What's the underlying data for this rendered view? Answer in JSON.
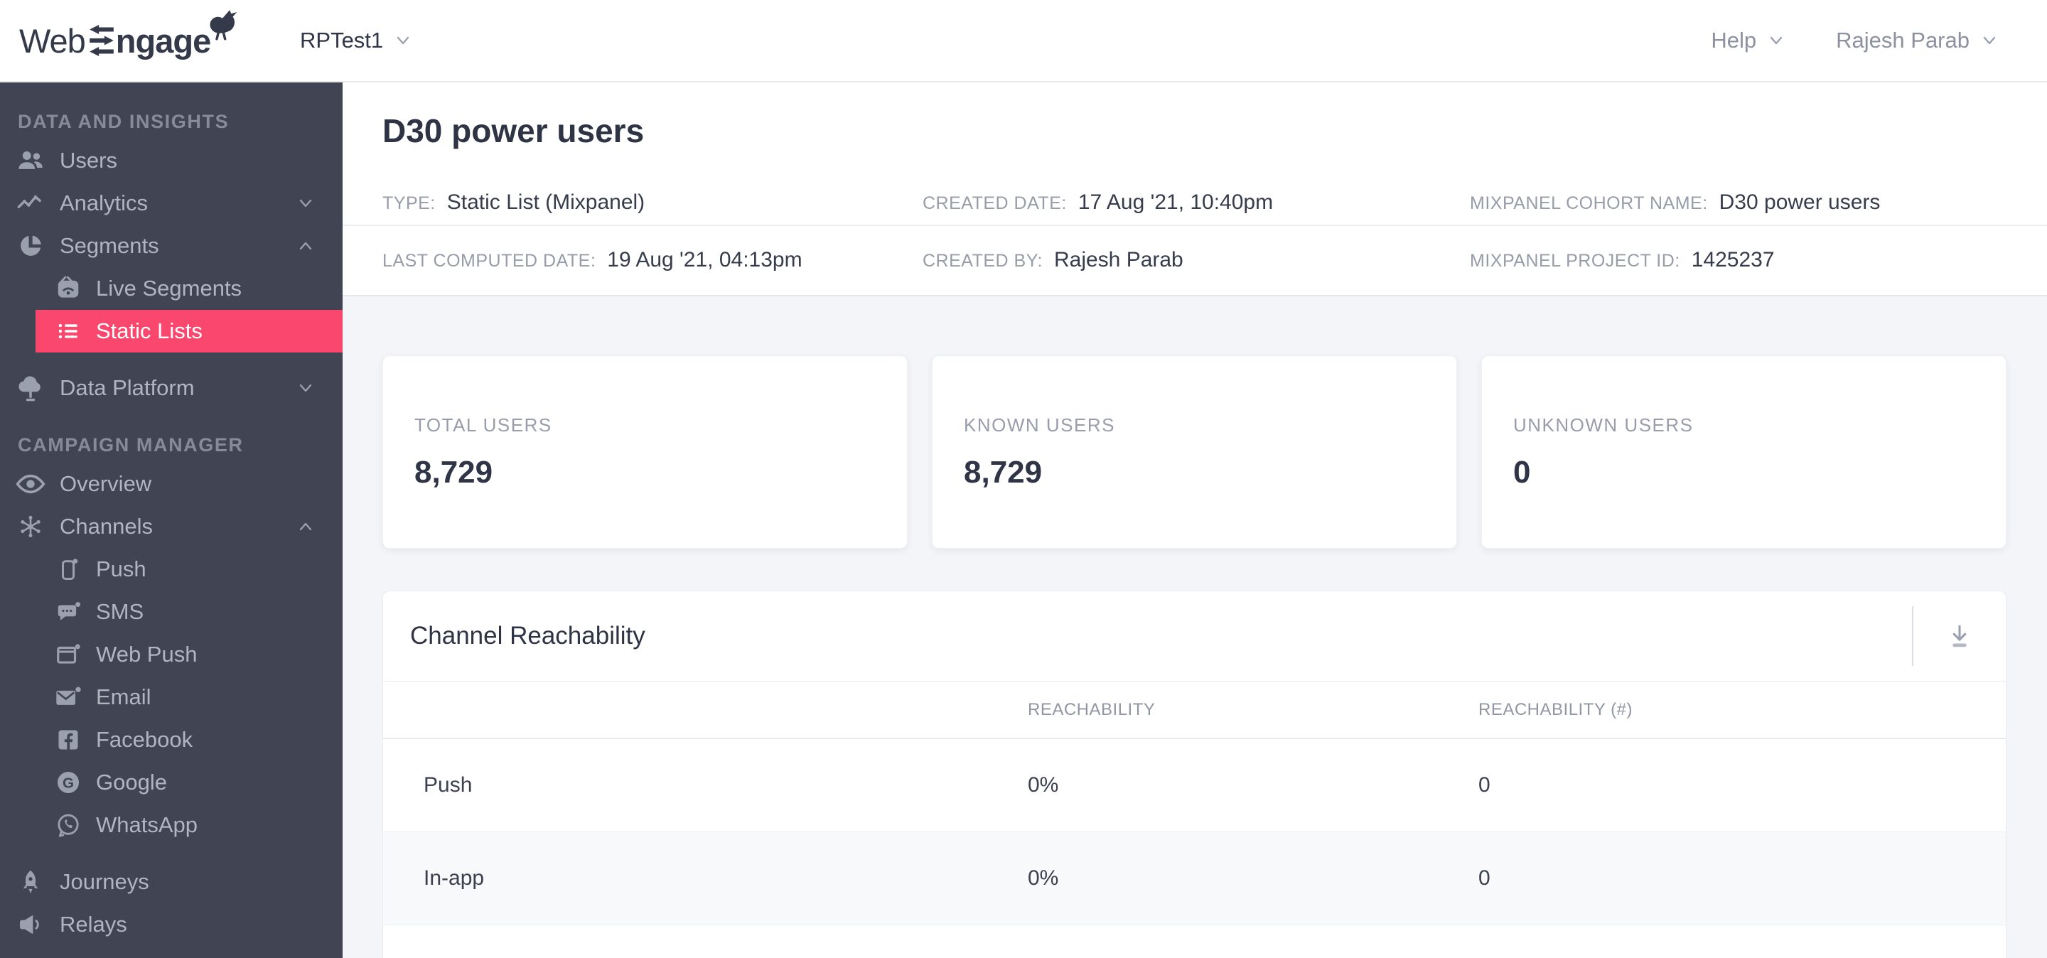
{
  "topbar": {
    "logo_web": "Web",
    "logo_engage": "ngage",
    "project": "RPTest1",
    "help_label": "Help",
    "user_name": "Rajesh Parab"
  },
  "sidebar": {
    "sections": [
      {
        "label": "DATA AND INSIGHTS",
        "items": [
          {
            "label": "Users"
          },
          {
            "label": "Analytics"
          },
          {
            "label": "Segments",
            "children": [
              {
                "label": "Live Segments"
              },
              {
                "label": "Static Lists",
                "active": true
              }
            ]
          },
          {
            "label": "Data Platform"
          }
        ]
      },
      {
        "label": "CAMPAIGN MANAGER",
        "items": [
          {
            "label": "Overview"
          },
          {
            "label": "Channels",
            "children": [
              {
                "label": "Push"
              },
              {
                "label": "SMS"
              },
              {
                "label": "Web Push"
              },
              {
                "label": "Email"
              },
              {
                "label": "Facebook"
              },
              {
                "label": "Google"
              },
              {
                "label": "WhatsApp"
              }
            ]
          },
          {
            "label": "Journeys"
          },
          {
            "label": "Relays"
          }
        ]
      }
    ]
  },
  "page": {
    "title": "D30 power users",
    "meta": [
      {
        "label": "TYPE:",
        "value": "Static List (Mixpanel)"
      },
      {
        "label": "CREATED DATE:",
        "value": "17 Aug '21, 10:40pm"
      },
      {
        "label": "MIXPANEL COHORT NAME:",
        "value": "D30 power users"
      },
      {
        "label": "LAST COMPUTED DATE:",
        "value": "19 Aug '21, 04:13pm"
      },
      {
        "label": "CREATED BY:",
        "value": "Rajesh Parab"
      },
      {
        "label": "MIXPANEL PROJECT ID:",
        "value": "1425237"
      }
    ]
  },
  "stats": [
    {
      "label": "TOTAL USERS",
      "value": "8,729"
    },
    {
      "label": "KNOWN USERS",
      "value": "8,729"
    },
    {
      "label": "UNKNOWN USERS",
      "value": "0"
    }
  ],
  "reachability": {
    "title": "Channel Reachability",
    "columns": [
      "REACHABILITY",
      "REACHABILITY (#)"
    ],
    "rows": [
      {
        "channel": "Push",
        "percent": "0%",
        "count": "0"
      },
      {
        "channel": "In-app",
        "percent": "0%",
        "count": "0"
      }
    ]
  },
  "colors": {
    "accent": "#f9476d",
    "sidebar_bg": "#404453",
    "page_bg": "#f4f5f8"
  }
}
